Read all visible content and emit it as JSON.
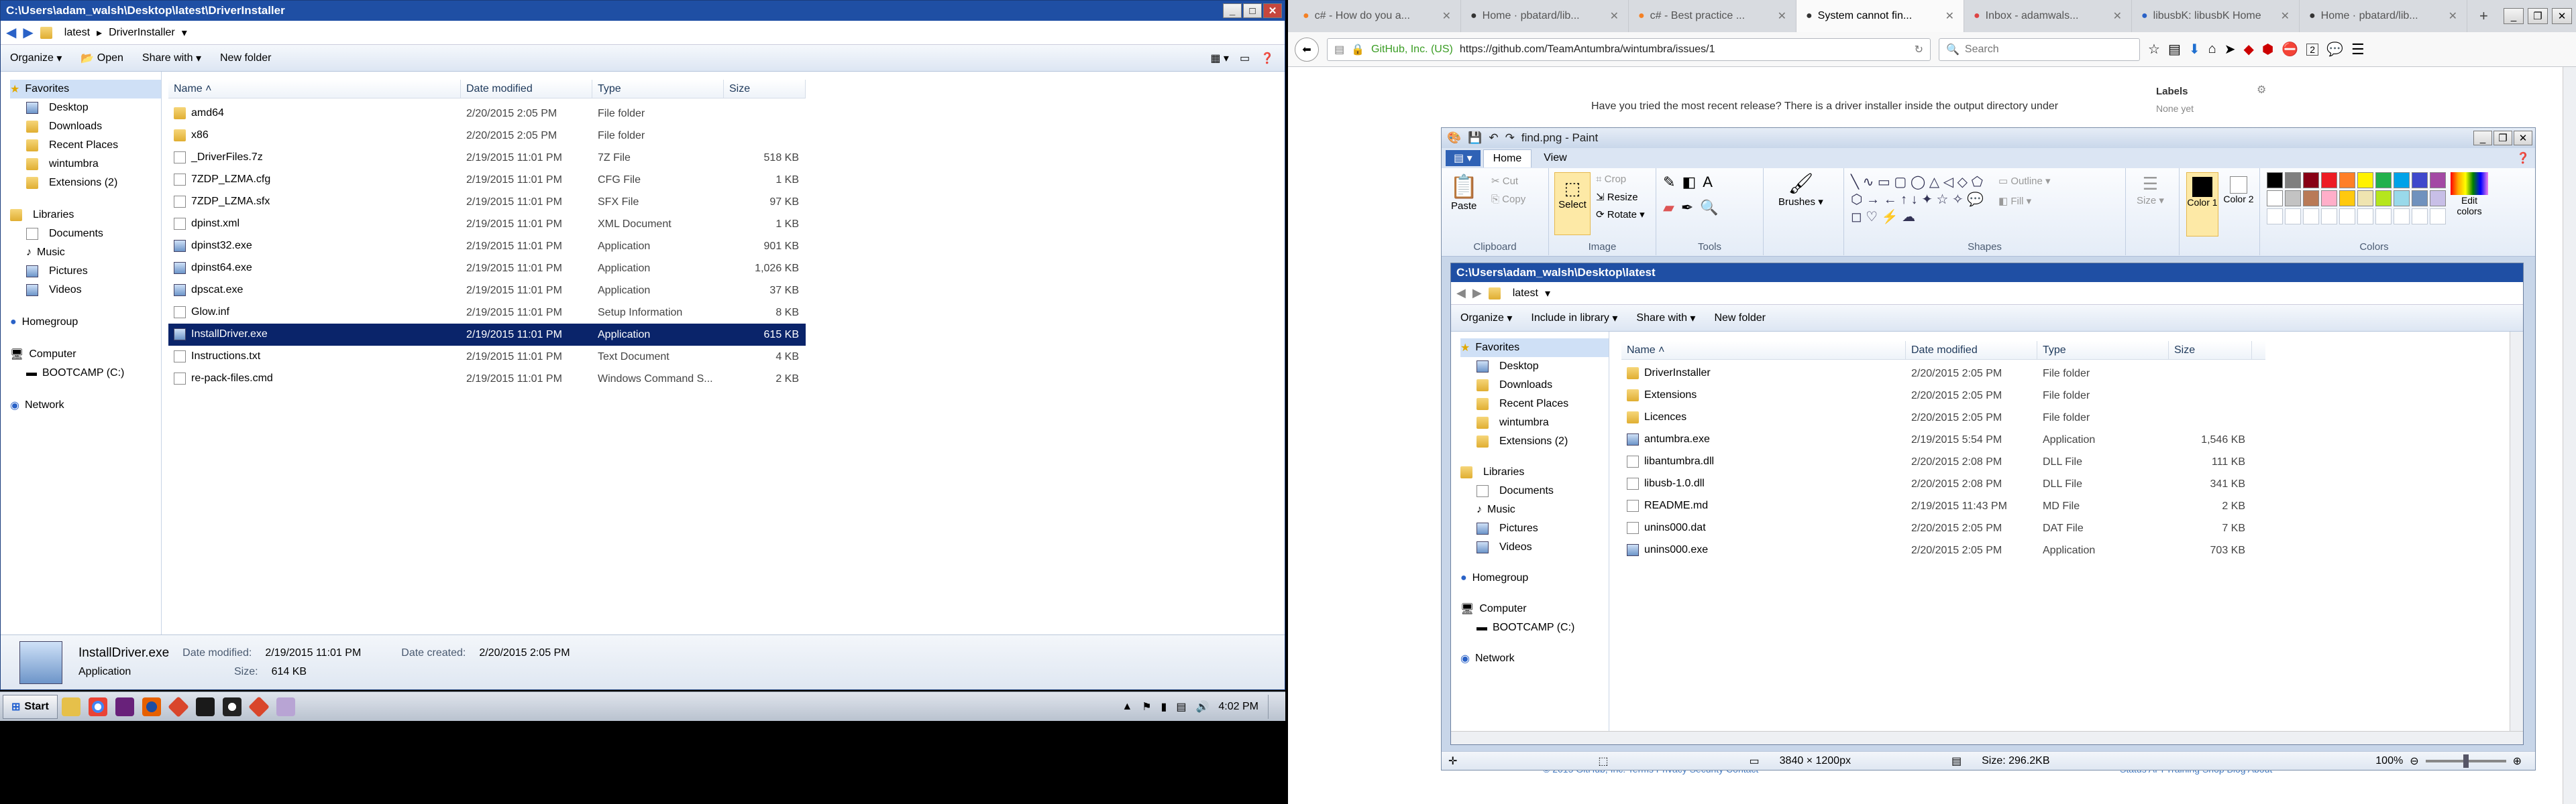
{
  "explorer_left": {
    "title": "C:\\Users\\adam_walsh\\Desktop\\latest\\DriverInstaller",
    "breadcrumb": [
      "latest",
      "DriverInstaller"
    ],
    "commands": {
      "organize": "Organize",
      "open": "Open",
      "share": "Share with",
      "new_folder": "New folder"
    },
    "nav": {
      "favorites": "Favorites",
      "desktop": "Desktop",
      "downloads": "Downloads",
      "recent": "Recent Places",
      "wintumbra": "wintumbra",
      "extensions": "Extensions (2)",
      "libraries": "Libraries",
      "documents": "Documents",
      "music": "Music",
      "pictures": "Pictures",
      "videos": "Videos",
      "homegroup": "Homegroup",
      "computer": "Computer",
      "bootcamp": "BOOTCAMP (C:)",
      "network": "Network"
    },
    "columns": {
      "name": "Name",
      "date": "Date modified",
      "type": "Type",
      "size": "Size"
    },
    "files": [
      {
        "name": "amd64",
        "date": "2/20/2015 2:05 PM",
        "type": "File folder",
        "size": "",
        "icon": "folder-icon"
      },
      {
        "name": "x86",
        "date": "2/20/2015 2:05 PM",
        "type": "File folder",
        "size": "",
        "icon": "folder-icon"
      },
      {
        "name": "_DriverFiles.7z",
        "date": "2/19/2015 11:01 PM",
        "type": "7Z File",
        "size": "518 KB",
        "icon": "file-icon"
      },
      {
        "name": "7ZDP_LZMA.cfg",
        "date": "2/19/2015 11:01 PM",
        "type": "CFG File",
        "size": "1 KB",
        "icon": "file-icon"
      },
      {
        "name": "7ZDP_LZMA.sfx",
        "date": "2/19/2015 11:01 PM",
        "type": "SFX File",
        "size": "97 KB",
        "icon": "file-icon"
      },
      {
        "name": "dpinst.xml",
        "date": "2/19/2015 11:01 PM",
        "type": "XML Document",
        "size": "1 KB",
        "icon": "file-icon"
      },
      {
        "name": "dpinst32.exe",
        "date": "2/19/2015 11:01 PM",
        "type": "Application",
        "size": "901 KB",
        "icon": "app-icon"
      },
      {
        "name": "dpinst64.exe",
        "date": "2/19/2015 11:01 PM",
        "type": "Application",
        "size": "1,026 KB",
        "icon": "app-icon"
      },
      {
        "name": "dpscat.exe",
        "date": "2/19/2015 11:01 PM",
        "type": "Application",
        "size": "37 KB",
        "icon": "app-icon"
      },
      {
        "name": "Glow.inf",
        "date": "2/19/2015 11:01 PM",
        "type": "Setup Information",
        "size": "8 KB",
        "icon": "file-icon"
      },
      {
        "name": "InstallDriver.exe",
        "date": "2/19/2015 11:01 PM",
        "type": "Application",
        "size": "615 KB",
        "icon": "app-icon"
      },
      {
        "name": "Instructions.txt",
        "date": "2/19/2015 11:01 PM",
        "type": "Text Document",
        "size": "4 KB",
        "icon": "file-icon"
      },
      {
        "name": "re-pack-files.cmd",
        "date": "2/19/2015 11:01 PM",
        "type": "Windows Command S...",
        "size": "2 KB",
        "icon": "file-icon"
      }
    ],
    "details": {
      "name": "InstallDriver.exe",
      "modified_label": "Date modified:",
      "modified": "2/19/2015 11:01 PM",
      "created_label": "Date created:",
      "created": "2/20/2015 2:05 PM",
      "type": "Application",
      "size_label": "Size:",
      "size": "614 KB"
    }
  },
  "taskbar": {
    "start": "Start",
    "clock": "4:02 PM"
  },
  "browser": {
    "tabs": [
      {
        "label": "c# - How do you a...",
        "active": false
      },
      {
        "label": "Home · pbatard/lib...",
        "active": false
      },
      {
        "label": "c# - Best practice ...",
        "active": false
      },
      {
        "label": "System cannot fin...",
        "active": true
      },
      {
        "label": "Inbox - adamwals...",
        "active": false
      },
      {
        "label": "libusbK: libusbK Home",
        "active": false
      },
      {
        "label": "Home · pbatard/lib...",
        "active": false
      }
    ],
    "site_identity": "GitHub, Inc. (US)",
    "url": "https://github.com/TeamAntumbra/wintumbra/issues/1",
    "search_placeholder": "Search",
    "badge_count": "2",
    "issue_comment": "Have you tried the most recent release? There is a driver installer inside the output directory under",
    "sidebar_labels": "Labels",
    "sidebar_none": "None yet",
    "footer_text": "© 2015 GitHub, Inc.   Terms   Privacy   Security   Contact",
    "footer_right": "Status   API   Training   Shop   Blog   About"
  },
  "paint": {
    "title": "find.png - Paint",
    "tabs": {
      "home": "Home",
      "view": "View"
    },
    "clipboard": {
      "paste": "Paste",
      "cut": "Cut",
      "copy": "Copy",
      "label": "Clipboard"
    },
    "image": {
      "select": "Select",
      "crop": "Crop",
      "resize": "Resize",
      "rotate": "Rotate",
      "label": "Image"
    },
    "tools_label": "Tools",
    "brushes": "Brushes",
    "shapes": {
      "outline": "Outline",
      "fill": "Fill",
      "label": "Shapes"
    },
    "size": "Size",
    "color1": "Color 1",
    "color2": "Color 2",
    "edit_colors": "Edit colors",
    "colors_label": "Colors",
    "palette": [
      "#000000",
      "#7f7f7f",
      "#880015",
      "#ed1c24",
      "#ff7f27",
      "#fff200",
      "#22b14c",
      "#00a2e8",
      "#3f48cc",
      "#a349a4",
      "#ffffff",
      "#c3c3c3",
      "#b97a57",
      "#ffaec9",
      "#ffc90e",
      "#efe4b0",
      "#b5e61d",
      "#99d9ea",
      "#7092be",
      "#c8bfe7"
    ],
    "status": {
      "dimensions": "3840 × 1200px",
      "size": "Size: 296.2KB",
      "zoom": "100%"
    }
  },
  "explorer_inner": {
    "title": "C:\\Users\\adam_walsh\\Desktop\\latest",
    "breadcrumb": "latest",
    "commands": {
      "organize": "Organize",
      "library": "Include in library",
      "share": "Share with",
      "new_folder": "New folder"
    },
    "nav": {
      "favorites": "Favorites",
      "desktop": "Desktop",
      "downloads": "Downloads",
      "recent": "Recent Places",
      "wintumbra": "wintumbra",
      "extensions": "Extensions (2)",
      "libraries": "Libraries",
      "documents": "Documents",
      "music": "Music",
      "pictures": "Pictures",
      "videos": "Videos",
      "homegroup": "Homegroup",
      "computer": "Computer",
      "bootcamp": "BOOTCAMP (C:)",
      "network": "Network"
    },
    "columns": {
      "name": "Name",
      "date": "Date modified",
      "type": "Type",
      "size": "Size"
    },
    "files": [
      {
        "name": "DriverInstaller",
        "date": "2/20/2015 2:05 PM",
        "type": "File folder",
        "size": "",
        "icon": "folder-icon"
      },
      {
        "name": "Extensions",
        "date": "2/20/2015 2:05 PM",
        "type": "File folder",
        "size": "",
        "icon": "folder-icon"
      },
      {
        "name": "Licences",
        "date": "2/20/2015 2:05 PM",
        "type": "File folder",
        "size": "",
        "icon": "folder-icon"
      },
      {
        "name": "antumbra.exe",
        "date": "2/19/2015 5:54 PM",
        "type": "Application",
        "size": "1,546 KB",
        "icon": "app-icon"
      },
      {
        "name": "libantumbra.dll",
        "date": "2/20/2015 2:08 PM",
        "type": "DLL File",
        "size": "111 KB",
        "icon": "file-icon"
      },
      {
        "name": "libusb-1.0.dll",
        "date": "2/20/2015 2:08 PM",
        "type": "DLL File",
        "size": "341 KB",
        "icon": "file-icon"
      },
      {
        "name": "README.md",
        "date": "2/19/2015 11:43 PM",
        "type": "MD File",
        "size": "2 KB",
        "icon": "file-icon"
      },
      {
        "name": "unins000.dat",
        "date": "2/20/2015 2:05 PM",
        "type": "DAT File",
        "size": "7 KB",
        "icon": "file-icon"
      },
      {
        "name": "unins000.exe",
        "date": "2/20/2015 2:05 PM",
        "type": "Application",
        "size": "703 KB",
        "icon": "app-icon"
      }
    ]
  }
}
